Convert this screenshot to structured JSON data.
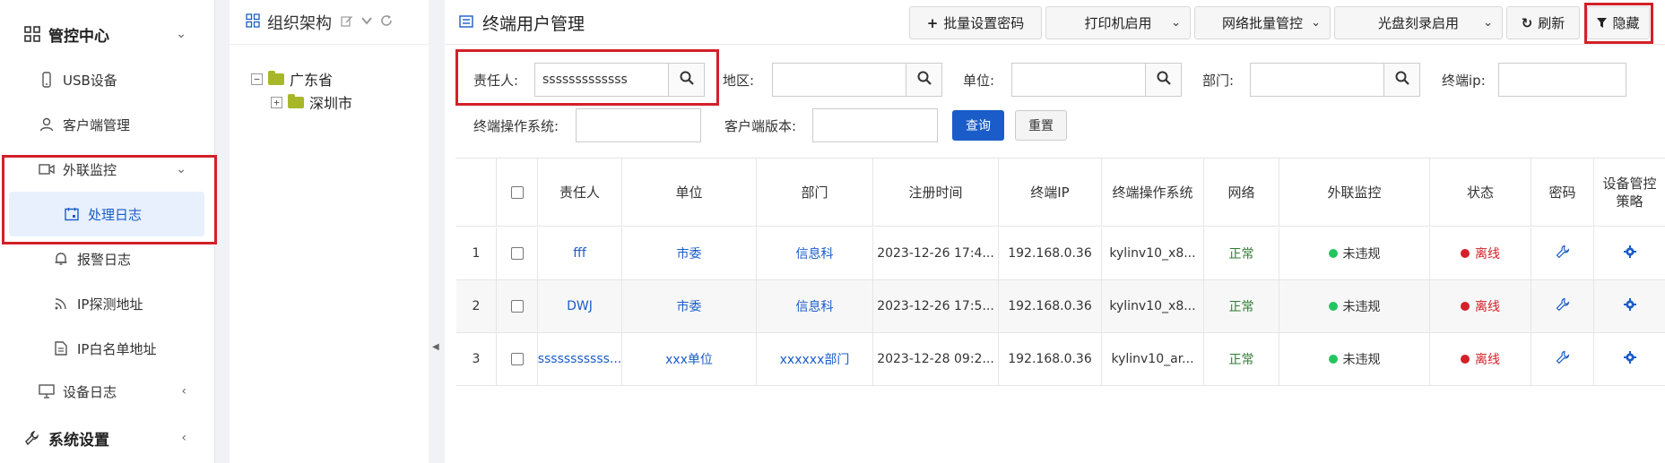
{
  "sidebar": {
    "items": [
      {
        "label": "管控中心",
        "icon": "grid-icon",
        "chevron": "⌄"
      },
      {
        "label": "USB设备",
        "icon": "usb-icon"
      },
      {
        "label": "客户端管理",
        "icon": "user-icon"
      },
      {
        "label": "外联监控",
        "icon": "video-icon",
        "chevron": "⌄"
      },
      {
        "label": "处理日志",
        "icon": "calendar-icon"
      },
      {
        "label": "报警日志",
        "icon": "bell-icon"
      },
      {
        "label": "IP探测地址",
        "icon": "signal-icon"
      },
      {
        "label": "IP白名单地址",
        "icon": "document-icon"
      },
      {
        "label": "设备日志",
        "icon": "monitor-icon",
        "chevron": "‹"
      },
      {
        "label": "系统设置",
        "icon": "wrench-icon",
        "chevron": "‹"
      }
    ]
  },
  "tree": {
    "title": "组织架构",
    "nodes": [
      {
        "label": "广东省",
        "expander": "−"
      },
      {
        "label": "深圳市",
        "expander": "+"
      }
    ]
  },
  "main": {
    "title": "终端用户管理",
    "toolbar": {
      "batch_password": "批量设置密码",
      "printer": "打印机启用",
      "network": "网络批量管控",
      "disc": "光盘刻录启用",
      "refresh": "刷新",
      "hide": "隐藏"
    },
    "filters": {
      "owner_label": "责任人:",
      "owner_value": "sssssssssssss",
      "region_label": "地区:",
      "unit_label": "单位:",
      "dept_label": "部门:",
      "ip_label": "终端ip:",
      "os_label": "终端操作系统:",
      "client_label": "客户端版本:",
      "query": "查询",
      "reset": "重置"
    },
    "table": {
      "headers": [
        "",
        "",
        "责任人",
        "单位",
        "部门",
        "注册时间",
        "终端IP",
        "终端操作系统",
        "网络",
        "外联监控",
        "状态",
        "密码",
        "设备管控策略"
      ],
      "rows": [
        {
          "no": "1",
          "owner": "fff",
          "unit": "市委",
          "dept": "信息科",
          "time": "2023-12-26 17:4...",
          "ip": "192.168.0.36",
          "os": "kylinv10_x8...",
          "net": "正常",
          "monitor": "未违规",
          "status": "离线"
        },
        {
          "no": "2",
          "owner": "DWJ",
          "unit": "市委",
          "dept": "信息科",
          "time": "2023-12-26 17:5...",
          "ip": "192.168.0.36",
          "os": "kylinv10_x8...",
          "net": "正常",
          "monitor": "未违规",
          "status": "离线"
        },
        {
          "no": "3",
          "owner": "sssssssssss...",
          "unit": "xxx单位",
          "dept": "xxxxxx部门",
          "time": "2023-12-28 09:2...",
          "ip": "192.168.0.36",
          "os": "kylinv10_ar...",
          "net": "正常",
          "monitor": "未违规",
          "status": "离线"
        }
      ]
    }
  },
  "colors": {
    "accent": "#1a5cc8",
    "highlight_box": "#d32029",
    "ok_dot": "#22c55e",
    "off_dot": "#d32029"
  }
}
